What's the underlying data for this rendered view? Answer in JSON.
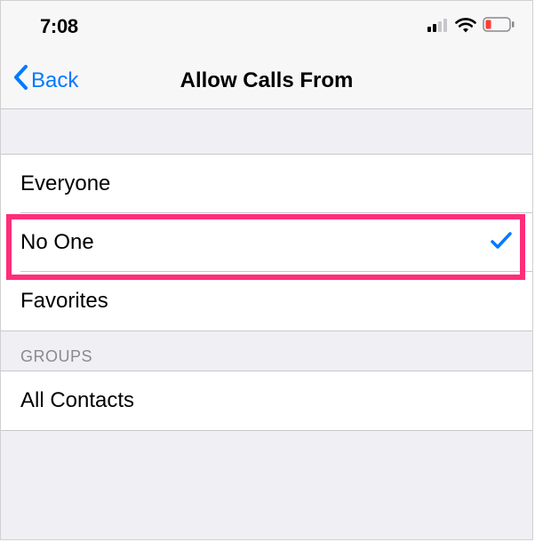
{
  "status": {
    "time": "7:08"
  },
  "nav": {
    "back_label": "Back",
    "title": "Allow Calls From"
  },
  "options": {
    "everyone": "Everyone",
    "no_one": "No One",
    "favorites": "Favorites"
  },
  "groups": {
    "header": "GROUPS",
    "all_contacts": "All Contacts"
  },
  "selected": "no_one"
}
